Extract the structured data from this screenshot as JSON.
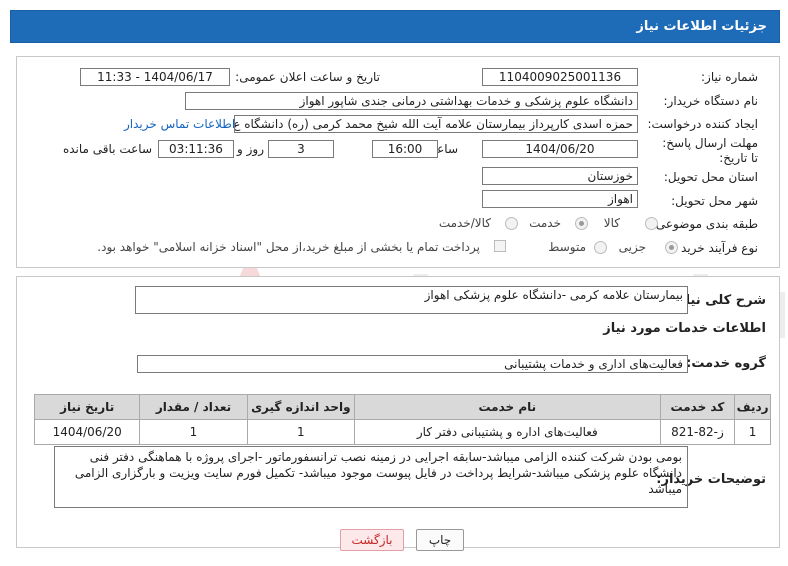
{
  "header": {
    "title": "جزئیات اطلاعات نیاز"
  },
  "form": {
    "need_number_label": "شماره نیاز:",
    "need_number": "1104009025001136",
    "announce_label": "تاریخ و ساعت اعلان عمومی:",
    "announce_value": "1404/06/17 - 11:33",
    "buyer_org_label": "نام دستگاه خریدار:",
    "buyer_org": "دانشگاه علوم پزشکی و خدمات بهداشتی درمانی جندی شاپور اهواز",
    "requester_label": "ایجاد کننده درخواست:",
    "requester": "حمزه اسدی کارپرداز بیمارستان علامه آیت الله شیخ محمد کرمی (ره) دانشگاه ع",
    "contact_link": "اطلاعات تماس خریدار",
    "deadline_label": "مهلت ارسال پاسخ: تا تاریخ:",
    "deadline_date": "1404/06/20",
    "time_label": "ساعت",
    "deadline_time": "16:00",
    "days_value": "3",
    "days_label": "روز و",
    "remaining_time": "03:11:36",
    "remaining_label": "ساعت باقی مانده",
    "province_label": "استان محل تحویل:",
    "province": "خوزستان",
    "city_label": "شهر محل تحویل:",
    "city": "اهواز",
    "category_label": "طبقه بندی موضوعی:",
    "category_options": [
      "کالا",
      "خدمت",
      "کالا/خدمت"
    ],
    "category_selected": "خدمت",
    "process_label": "نوع فرآیند خرید :",
    "process_options": [
      "جزیی",
      "متوسط"
    ],
    "process_selected": "جزیی",
    "payment_note": "پرداخت تمام یا بخشی از مبلغ خرید،از محل \"اسناد خزانه اسلامی\" خواهد بود."
  },
  "need": {
    "desc_label": "شرح کلی نیاز:",
    "desc": "بیمارستان علامه کرمی -دانشگاه علوم پزشکی اهواز",
    "services_title": "اطلاعات خدمات مورد نیاز",
    "group_label": "گروه خدمت:",
    "group": "فعالیت‌های اداری و خدمات پشتیبانی"
  },
  "table": {
    "headers": [
      "ردیف",
      "کد خدمت",
      "نام خدمت",
      "واحد اندازه گیری",
      "تعداد / مقدار",
      "تاریخ نیاز"
    ],
    "rows": [
      [
        "1",
        "ز-82-821",
        "فعالیت‌های اداره و پشتیبانی دفتر کار",
        "1",
        "1",
        "1404/06/20"
      ]
    ]
  },
  "buyer_notes": {
    "label": "توضیحات خریدار:",
    "text": "بومی بودن شرکت کننده الزامی میباشد-سابقه اجرایی در زمینه نصب ترانسفورماتور -اجرای پروژه با هماهنگی دفتر فنی دانشگاه علوم پزشکی میباشد-شرایط پرداخت در فایل پیوست موجود میباشد- تکمیل فورم سایت ویزیت و بارگزاری الزامی میباشد"
  },
  "buttons": {
    "print": "چاپ",
    "back": "بازگشت"
  },
  "watermark": {
    "text": "AriaTender.net"
  },
  "colors": {
    "header_bg": "#1e6bb8",
    "link": "#1565c0",
    "watermark": "#e57373"
  }
}
